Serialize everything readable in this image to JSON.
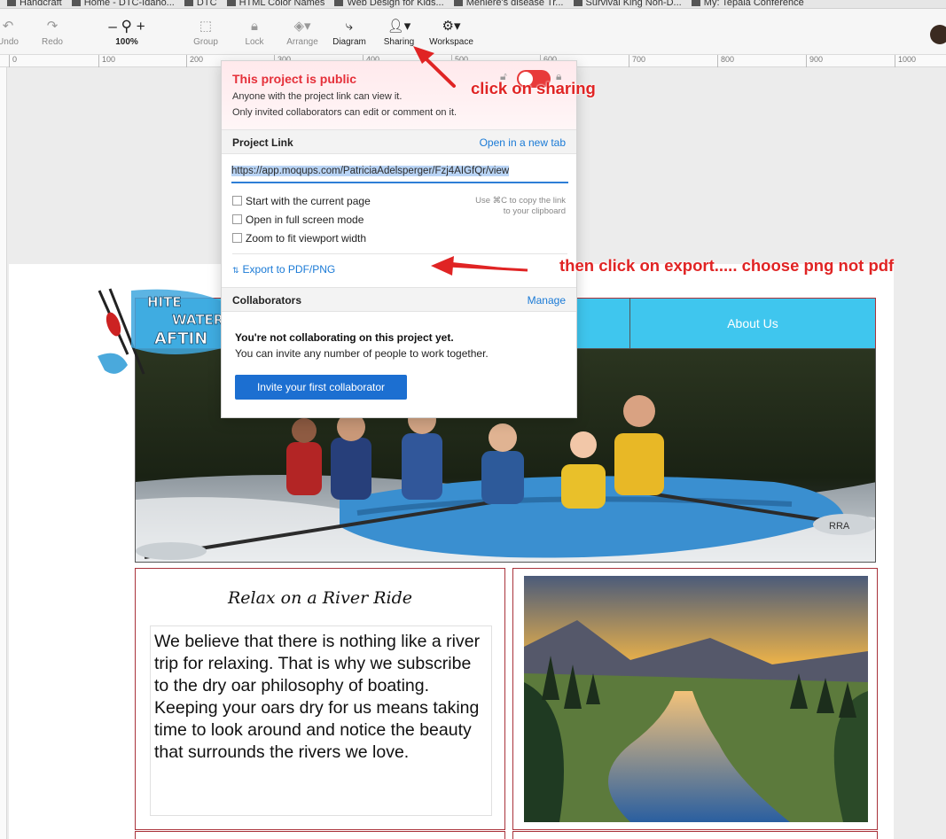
{
  "bookmarks": [
    "Handcraft",
    "Home - DTC-Idaho...",
    "DTC",
    "HTML Color Names",
    "Web Design for Kids...",
    "Meniere's disease Tr...",
    "Survival King Non-D...",
    "My: Tepala Conference"
  ],
  "toolbar": {
    "undo": "Undo",
    "redo": "Redo",
    "zoom_minus": "–",
    "zoom_plus": "+",
    "zoom_level": "100%",
    "group": "Group",
    "lock": "Lock",
    "arrange": "Arrange",
    "diagram": "Diagram",
    "sharing": "Sharing",
    "workspace": "Workspace"
  },
  "ruler": [
    "0",
    "100",
    "200",
    "300",
    "400",
    "500",
    "600",
    "700",
    "800",
    "900",
    "1000"
  ],
  "sharing_popup": {
    "public_title": "This project is public",
    "public_desc_1": "Anyone with the project link can view it.",
    "public_desc_2": "Only invited collaborators can edit or comment on it.",
    "public_toggle_on": true,
    "project_link_title": "Project Link",
    "open_new_tab": "Open in a new tab",
    "link_url": "https://app.moqups.com/PatriciaAdelsperger/Fzj4AIGfQr/view",
    "options": [
      "Start with the current page",
      "Open in full screen mode",
      "Zoom to fit viewport width"
    ],
    "copy_hint_1": "Use ⌘C to copy the link",
    "copy_hint_2": "to your clipboard",
    "export_label": "Export to PDF/PNG",
    "collaborators_title": "Collaborators",
    "manage": "Manage",
    "not_collab_title": "You're not collaborating on this project yet.",
    "not_collab_desc": "You can invite any number of people to work together.",
    "invite_button": "Invite your first collaborator"
  },
  "annotations": {
    "sharing": "click on sharing",
    "export": "then click on export..... choose png not pdf"
  },
  "mockup": {
    "logo_text": [
      "HITE",
      "WATER",
      "AFTIN"
    ],
    "nav_about": "About Us",
    "hero_alt": "family rafting photo",
    "card_title": "Relax on a River Ride",
    "card_text": "We believe that there is nothing like a river trip for relaxing. That is why we subscribe to the dry oar philosophy of boating. Keeping your oars dry for us means taking time to look around and notice the beauty that surrounds the rivers we love.",
    "raft_label": "RRA"
  },
  "colors": {
    "accent_red": "#e02424",
    "link_blue": "#1a7ad6",
    "nav_cyan": "#3fc6ee",
    "button_blue": "#1c6fd1"
  }
}
